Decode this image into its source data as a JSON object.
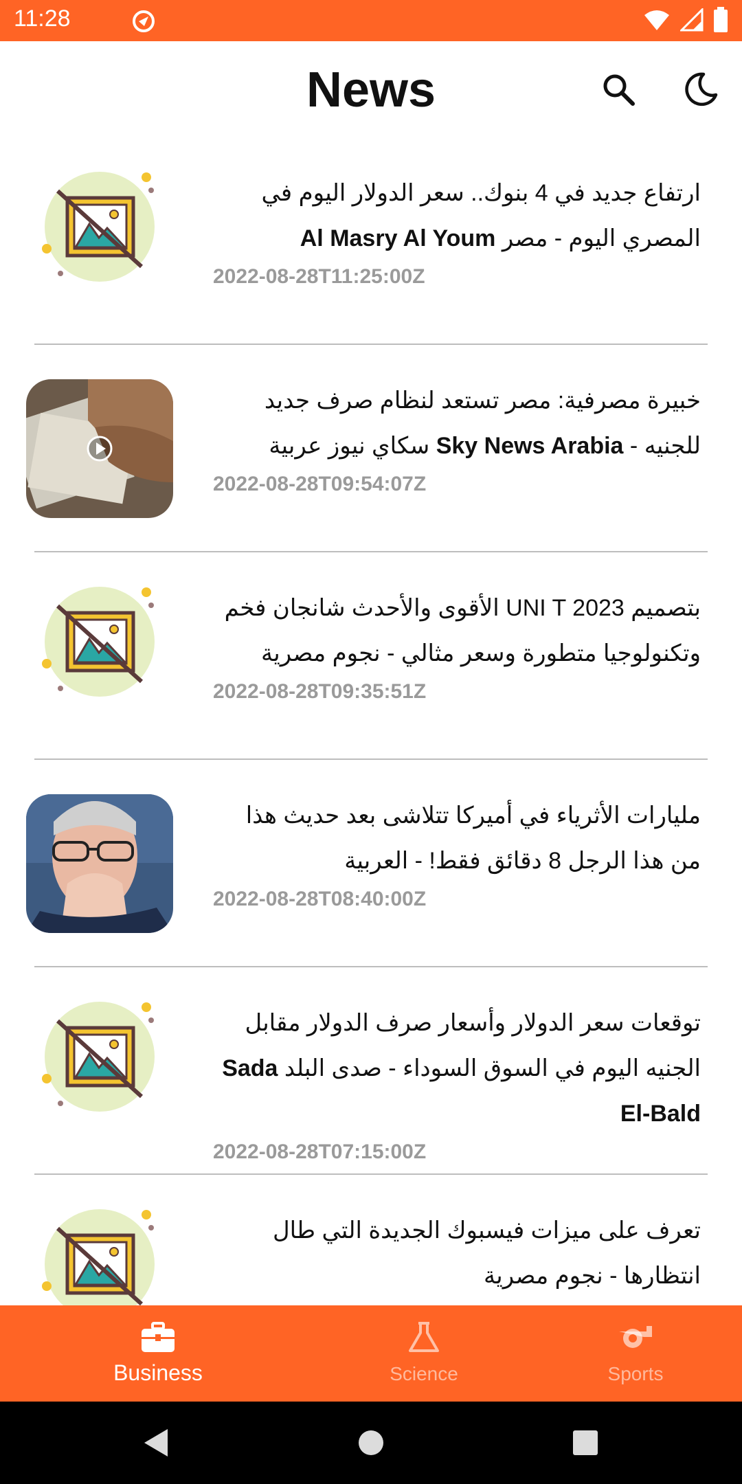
{
  "status_bar": {
    "time": "11:28"
  },
  "app_bar": {
    "title": "News"
  },
  "articles": [
    {
      "title": "ارتفاع جديد في 4 بنوك.. سعر الدولار اليوم في المصري اليوم - مصر",
      "source": "Al Masry Al Youm",
      "date": "2022-08-28T11:25:00Z",
      "thumbnail": "image-placeholder-icon"
    },
    {
      "title": "خبيرة مصرفية: مصر تستعد لنظام صرف جديد للجنيه",
      "source": "Sky News Arabia",
      "source_suffix": "سكاي نيوز عربية",
      "date": "2022-08-28T09:54:07Z",
      "thumbnail": "money-video-thumbnail"
    },
    {
      "title": "بتصميم UNI T 2023 الأقوى والأحدث شانجان فخم وتكنولوجيا متطورة وسعر مثالي - نجوم مصرية",
      "date": "2022-08-28T09:35:51Z",
      "thumbnail": "image-placeholder-icon"
    },
    {
      "title": "مليارات الأثرياء في أميركا تتلاشى بعد حديث هذا من هذا الرجل 8 دقائق فقط! - العربية",
      "date": "2022-08-28T08:40:00Z",
      "thumbnail": "man-portrait-thumbnail"
    },
    {
      "title": "توقعات سعر الدولار وأسعار صرف الدولار مقابل الجنيه اليوم في السوق السوداء - صدى البلد",
      "source": "Sada El-Bald",
      "date": "2022-08-28T07:15:00Z",
      "thumbnail": "image-placeholder-icon"
    },
    {
      "title": "تعرف على ميزات فيسبوك الجديدة التي طال انتظارها - نجوم مصرية",
      "date": "",
      "thumbnail": "image-placeholder-icon"
    }
  ],
  "bottom_nav": {
    "items": [
      {
        "label": "Business",
        "icon": "briefcase-icon",
        "active": true
      },
      {
        "label": "Science",
        "icon": "flask-icon",
        "active": false
      },
      {
        "label": "Sports",
        "icon": "whistle-icon",
        "active": false
      }
    ]
  },
  "colors": {
    "accent": "#ff6425",
    "date_gray": "#9a9a9a",
    "divider": "#bdbdbd"
  }
}
